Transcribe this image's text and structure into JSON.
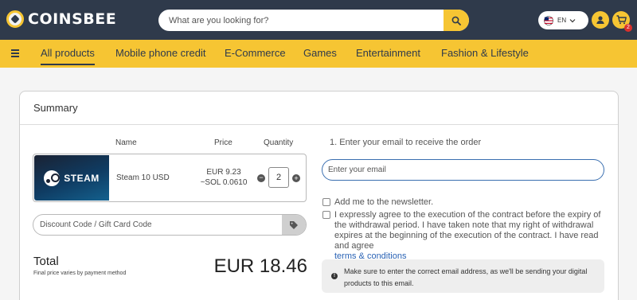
{
  "header": {
    "logo_text": "COINSBEE",
    "search_placeholder": "What are you looking for?",
    "language": "EN",
    "cart_count": "2"
  },
  "nav": {
    "items": [
      "All products",
      "Mobile phone credit",
      "E-Commerce",
      "Games",
      "Entertainment",
      "Fashion & Lifestyle"
    ],
    "active": "All products"
  },
  "summary": {
    "title": "Summary",
    "columns": {
      "name": "Name",
      "price": "Price",
      "quantity": "Quantity"
    },
    "product": {
      "brand": "STEAM",
      "name": "Steam 10 USD",
      "price_eur": "EUR 9.23",
      "price_sol": "~SOL 0.0610",
      "quantity": "2"
    },
    "discount_placeholder": "Discount Code / Gift Card Code",
    "total_label": "Total",
    "total_note": "Final price varies by payment method",
    "total_value": "EUR 18.46"
  },
  "checkout": {
    "email_label": "1. Enter your email to receive the order",
    "email_placeholder": "Enter your email",
    "newsletter_label": "Add me to the newsletter.",
    "agreement_text": "I expressly agree to the execution of the contract before the expiry of the withdrawal period. I have taken note that my right of withdrawal expires at the beginning of the execution of the contract. I have read and agree",
    "terms_link": "terms & conditions",
    "info_text": "Make sure to enter the correct email address, as we'll be sending your digital products to this email."
  },
  "colors": {
    "header_bg": "#2f3a4b",
    "accent": "#f6c533",
    "link": "#2a63b5",
    "email_border": "#3a6fb0"
  }
}
